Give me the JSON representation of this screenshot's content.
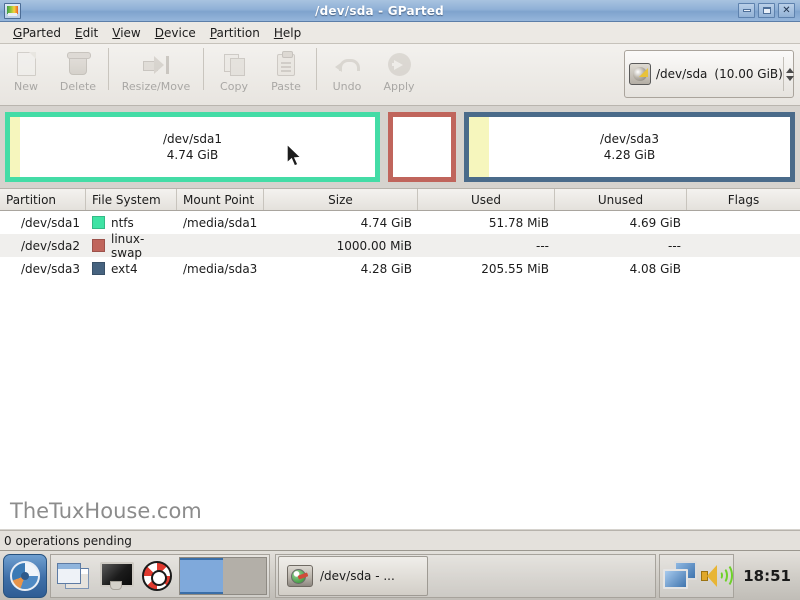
{
  "window": {
    "title": "/dev/sda - GParted",
    "icon": "gparted-icon",
    "controls": {
      "minimize": "_",
      "maximize": "□",
      "close": "✕"
    }
  },
  "menubar": {
    "items": [
      {
        "label": "GParted",
        "mnemonic": "G"
      },
      {
        "label": "Edit",
        "mnemonic": "E"
      },
      {
        "label": "View",
        "mnemonic": "V"
      },
      {
        "label": "Device",
        "mnemonic": "D"
      },
      {
        "label": "Partition",
        "mnemonic": "P"
      },
      {
        "label": "Help",
        "mnemonic": "H"
      }
    ]
  },
  "toolbar": {
    "buttons": [
      {
        "label": "New",
        "icon": "new-document-icon",
        "enabled": false
      },
      {
        "label": "Delete",
        "icon": "trash-icon",
        "enabled": false
      },
      {
        "label": "Resize/Move",
        "icon": "resize-arrow-icon",
        "enabled": false
      },
      {
        "label": "Copy",
        "icon": "copy-icon",
        "enabled": false
      },
      {
        "label": "Paste",
        "icon": "clipboard-icon",
        "enabled": false
      },
      {
        "label": "Undo",
        "icon": "undo-arrow-icon",
        "enabled": false
      },
      {
        "label": "Apply",
        "icon": "apply-arrow-icon",
        "enabled": false
      }
    ],
    "device_selector": {
      "icon": "harddisk-icon",
      "device": "/dev/sda",
      "size": "(10.00 GiB)"
    }
  },
  "graphic": {
    "partitions": [
      {
        "name": "/dev/sda1",
        "size_label": "4.74 GiB",
        "border_color": "#44dca6",
        "used_color": "#f6f6bd",
        "free_color": "#ffffff",
        "show_label": true
      },
      {
        "name": "/dev/sda2",
        "size_label": "1000.00 MiB",
        "border_color": "#c0655c",
        "used_color": "#ffffff",
        "free_color": "#ffffff",
        "show_label": false
      },
      {
        "name": "/dev/sda3",
        "size_label": "4.28 GiB",
        "border_color": "#4a6b8a",
        "used_color": "#f6f6bd",
        "free_color": "#ffffff",
        "show_label": true
      }
    ]
  },
  "table": {
    "columns": [
      "Partition",
      "File System",
      "Mount Point",
      "Size",
      "Used",
      "Unused",
      "Flags"
    ],
    "rows": [
      {
        "partition": "/dev/sda1",
        "filesystem": "ntfs",
        "fs_color": "#3fe3a4",
        "mount_point": "/media/sda1",
        "size": "4.74 GiB",
        "used": "51.78 MiB",
        "unused": "4.69 GiB",
        "flags": ""
      },
      {
        "partition": "/dev/sda2",
        "filesystem": "linux-swap",
        "fs_color": "#c0655c",
        "mount_point": "",
        "size": "1000.00 MiB",
        "used": "---",
        "unused": "---",
        "flags": ""
      },
      {
        "partition": "/dev/sda3",
        "filesystem": "ext4",
        "fs_color": "#46637f",
        "mount_point": "/media/sda3",
        "size": "4.28 GiB",
        "used": "205.55 MiB",
        "unused": "4.08 GiB",
        "flags": ""
      }
    ]
  },
  "watermark": "TheTuxHouse.com",
  "statusbar": {
    "text": "0 operations pending"
  },
  "taskbar": {
    "start": {
      "icon": "start-menu-icon"
    },
    "launchers": [
      {
        "icon": "show-windows-icon",
        "name": "window-list"
      },
      {
        "icon": "monitor-icon",
        "name": "show-desktop"
      },
      {
        "icon": "lifebuoy-icon",
        "name": "help-launcher"
      }
    ],
    "pager": {
      "workspaces": 2,
      "active": 1
    },
    "task_buttons": [
      {
        "label": "/dev/sda - ...",
        "icon": "harddisk-icon"
      }
    ],
    "tray": [
      {
        "icon": "network-icon",
        "name": "network-tray-icon"
      },
      {
        "icon": "volume-speaker-icon",
        "name": "volume-tray-icon"
      }
    ],
    "clock": "18:51"
  }
}
